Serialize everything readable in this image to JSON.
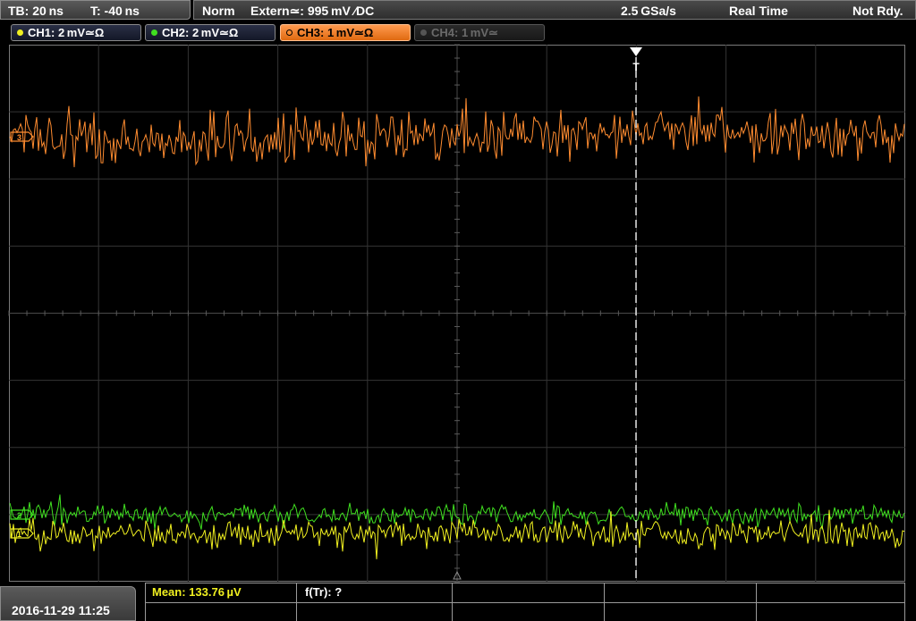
{
  "colors": {
    "ch1": "#f0f020",
    "ch2": "#40e020",
    "ch3": "#ff8c30",
    "ch4": "#555555",
    "grid": "#3a3a3a",
    "trigger_line": "#ffffff"
  },
  "status": {
    "timebase": "TB: 20 ns",
    "trigger_time": "T: -40 ns",
    "mode": "Norm",
    "trigger_source": "Extern≃: 995 mV ∕DC",
    "sample_rate": "2.5 GSa/s",
    "acq_mode": "Real Time",
    "state": "Not Rdy."
  },
  "channels": [
    {
      "label": "CH1: 2 mV≃Ω",
      "state": "on"
    },
    {
      "label": "CH2: 2 mV≃Ω",
      "state": "on"
    },
    {
      "label": "CH3: 1 mV≃Ω",
      "state": "active"
    },
    {
      "label": "CH4: 1 mV≃",
      "state": "off"
    }
  ],
  "markers": {
    "ch3": "3",
    "ch2": "2",
    "ch1": "1",
    "trigger": "T"
  },
  "measurements": {
    "mean": "Mean: 133.76 µV",
    "ftr": "f(Tr): ?"
  },
  "datetime": "2016-11-29 11:25"
}
